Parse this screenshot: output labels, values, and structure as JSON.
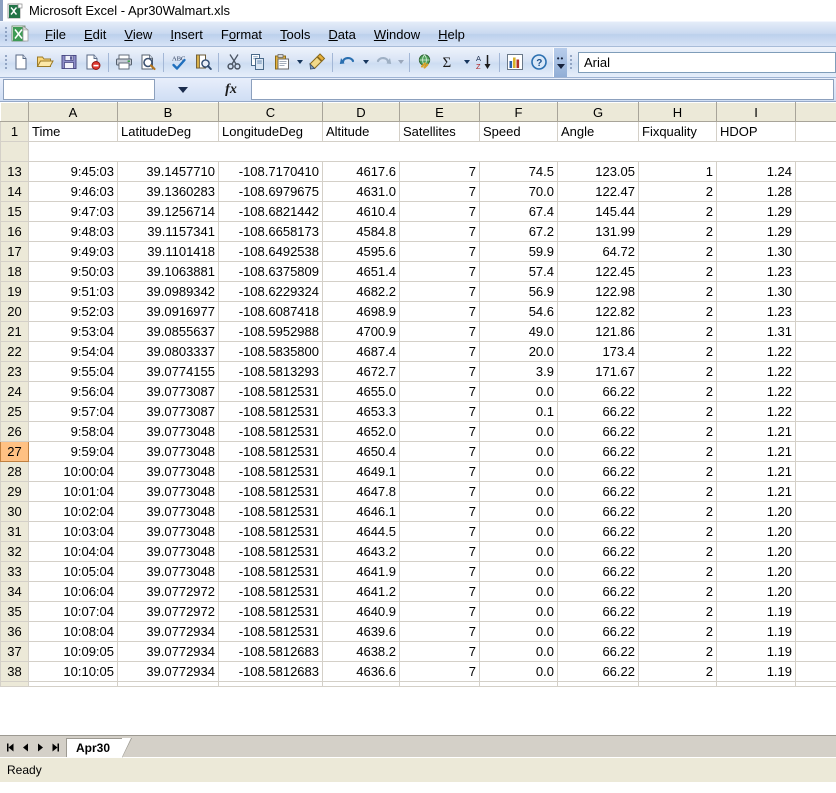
{
  "window": {
    "title": "Microsoft Excel - Apr30Walmart.xls",
    "app_icon": "excel-icon"
  },
  "menubar": {
    "items": [
      {
        "label": "File",
        "pre": "F",
        "rest": "ile"
      },
      {
        "label": "Edit",
        "pre": "E",
        "rest": "dit"
      },
      {
        "label": "View",
        "pre": "V",
        "rest": "iew"
      },
      {
        "label": "Insert",
        "pre": "I",
        "rest": "nsert"
      },
      {
        "label": "Format",
        "pre": "o",
        "rest": "rmat"
      },
      {
        "label": "Tools",
        "pre": "T",
        "rest": "ools"
      },
      {
        "label": "Data",
        "pre": "D",
        "rest": "ata"
      },
      {
        "label": "Window",
        "pre": "W",
        "rest": "indow"
      },
      {
        "label": "Help",
        "pre": "H",
        "rest": "elp"
      }
    ]
  },
  "toolbar": {
    "buttons": [
      "new-icon",
      "open-icon",
      "save-icon",
      "permission-icon",
      "print-icon",
      "print-preview-icon",
      "spelling-icon",
      "research-icon",
      "cut-icon",
      "copy-icon",
      "paste-icon",
      "format-painter-icon",
      "undo-icon",
      "redo-icon",
      "hyperlink-icon",
      "autosum-icon",
      "sort-ascending-icon",
      "chart-wizard-icon",
      "help-icon"
    ],
    "toolbar_options_label": "Toolbar Options",
    "font_name": "Arial"
  },
  "formula_bar": {
    "name_box_value": "",
    "name_box_dropdown": "chevron-down-icon",
    "fx_label": "fx",
    "formula_value": ""
  },
  "grid": {
    "columns": [
      "A",
      "B",
      "C",
      "D",
      "E",
      "F",
      "G",
      "H",
      "I"
    ],
    "headers": [
      "Time",
      "LatitudeDeg",
      "LongitudeDeg",
      "Altitude",
      "Satellites",
      "Speed",
      "Angle",
      "Fixquality",
      "HDOP"
    ],
    "header_row_number": "1",
    "selected_row": "27",
    "rows": [
      {
        "n": "13",
        "cells": [
          "9:45:03",
          "39.1457710",
          "-108.7170410",
          "4617.6",
          "7",
          "74.5",
          "123.05",
          "1",
          "1.24"
        ]
      },
      {
        "n": "14",
        "cells": [
          "9:46:03",
          "39.1360283",
          "-108.6979675",
          "4631.0",
          "7",
          "70.0",
          "122.47",
          "2",
          "1.28"
        ]
      },
      {
        "n": "15",
        "cells": [
          "9:47:03",
          "39.1256714",
          "-108.6821442",
          "4610.4",
          "7",
          "67.4",
          "145.44",
          "2",
          "1.29"
        ]
      },
      {
        "n": "16",
        "cells": [
          "9:48:03",
          "39.1157341",
          "-108.6658173",
          "4584.8",
          "7",
          "67.2",
          "131.99",
          "2",
          "1.29"
        ]
      },
      {
        "n": "17",
        "cells": [
          "9:49:03",
          "39.1101418",
          "-108.6492538",
          "4595.6",
          "7",
          "59.9",
          "64.72",
          "2",
          "1.30"
        ]
      },
      {
        "n": "18",
        "cells": [
          "9:50:03",
          "39.1063881",
          "-108.6375809",
          "4651.4",
          "7",
          "57.4",
          "122.45",
          "2",
          "1.23"
        ]
      },
      {
        "n": "19",
        "cells": [
          "9:51:03",
          "39.0989342",
          "-108.6229324",
          "4682.2",
          "7",
          "56.9",
          "122.98",
          "2",
          "1.30"
        ]
      },
      {
        "n": "20",
        "cells": [
          "9:52:03",
          "39.0916977",
          "-108.6087418",
          "4698.9",
          "7",
          "54.6",
          "122.82",
          "2",
          "1.23"
        ]
      },
      {
        "n": "21",
        "cells": [
          "9:53:04",
          "39.0855637",
          "-108.5952988",
          "4700.9",
          "7",
          "49.0",
          "121.86",
          "2",
          "1.31"
        ]
      },
      {
        "n": "22",
        "cells": [
          "9:54:04",
          "39.0803337",
          "-108.5835800",
          "4687.4",
          "7",
          "20.0",
          "173.4",
          "2",
          "1.22"
        ]
      },
      {
        "n": "23",
        "cells": [
          "9:55:04",
          "39.0774155",
          "-108.5813293",
          "4672.7",
          "7",
          "3.9",
          "171.67",
          "2",
          "1.22"
        ]
      },
      {
        "n": "24",
        "cells": [
          "9:56:04",
          "39.0773087",
          "-108.5812531",
          "4655.0",
          "7",
          "0.0",
          "66.22",
          "2",
          "1.22"
        ]
      },
      {
        "n": "25",
        "cells": [
          "9:57:04",
          "39.0773087",
          "-108.5812531",
          "4653.3",
          "7",
          "0.1",
          "66.22",
          "2",
          "1.22"
        ]
      },
      {
        "n": "26",
        "cells": [
          "9:58:04",
          "39.0773048",
          "-108.5812531",
          "4652.0",
          "7",
          "0.0",
          "66.22",
          "2",
          "1.21"
        ]
      },
      {
        "n": "27",
        "cells": [
          "9:59:04",
          "39.0773048",
          "-108.5812531",
          "4650.4",
          "7",
          "0.0",
          "66.22",
          "2",
          "1.21"
        ]
      },
      {
        "n": "28",
        "cells": [
          "10:00:04",
          "39.0773048",
          "-108.5812531",
          "4649.1",
          "7",
          "0.0",
          "66.22",
          "2",
          "1.21"
        ]
      },
      {
        "n": "29",
        "cells": [
          "10:01:04",
          "39.0773048",
          "-108.5812531",
          "4647.8",
          "7",
          "0.0",
          "66.22",
          "2",
          "1.21"
        ]
      },
      {
        "n": "30",
        "cells": [
          "10:02:04",
          "39.0773048",
          "-108.5812531",
          "4646.1",
          "7",
          "0.0",
          "66.22",
          "2",
          "1.20"
        ]
      },
      {
        "n": "31",
        "cells": [
          "10:03:04",
          "39.0773048",
          "-108.5812531",
          "4644.5",
          "7",
          "0.0",
          "66.22",
          "2",
          "1.20"
        ]
      },
      {
        "n": "32",
        "cells": [
          "10:04:04",
          "39.0773048",
          "-108.5812531",
          "4643.2",
          "7",
          "0.0",
          "66.22",
          "2",
          "1.20"
        ]
      },
      {
        "n": "33",
        "cells": [
          "10:05:04",
          "39.0773048",
          "-108.5812531",
          "4641.9",
          "7",
          "0.0",
          "66.22",
          "2",
          "1.20"
        ]
      },
      {
        "n": "34",
        "cells": [
          "10:06:04",
          "39.0772972",
          "-108.5812531",
          "4641.2",
          "7",
          "0.0",
          "66.22",
          "2",
          "1.20"
        ]
      },
      {
        "n": "35",
        "cells": [
          "10:07:04",
          "39.0772972",
          "-108.5812531",
          "4640.9",
          "7",
          "0.0",
          "66.22",
          "2",
          "1.19"
        ]
      },
      {
        "n": "36",
        "cells": [
          "10:08:04",
          "39.0772934",
          "-108.5812531",
          "4639.6",
          "7",
          "0.0",
          "66.22",
          "2",
          "1.19"
        ]
      },
      {
        "n": "37",
        "cells": [
          "10:09:05",
          "39.0772934",
          "-108.5812683",
          "4638.2",
          "7",
          "0.0",
          "66.22",
          "2",
          "1.19"
        ]
      },
      {
        "n": "38",
        "cells": [
          "10:10:05",
          "39.0772934",
          "-108.5812683",
          "4636.6",
          "7",
          "0.0",
          "66.22",
          "2",
          "1.19"
        ]
      }
    ]
  },
  "sheet_tabs": {
    "nav_first": "first-sheet-icon",
    "nav_prev": "previous-sheet-icon",
    "nav_next": "next-sheet-icon",
    "nav_last": "last-sheet-icon",
    "tabs": [
      {
        "label": "Apr30",
        "active": true
      }
    ]
  },
  "status_bar": {
    "text": "Ready"
  },
  "colors": {
    "header_bg": "#ece9d8",
    "selected_row_header": "#ffc183",
    "menu_bg": "#c9d9f0",
    "grid_line": "#d4d0c8"
  }
}
